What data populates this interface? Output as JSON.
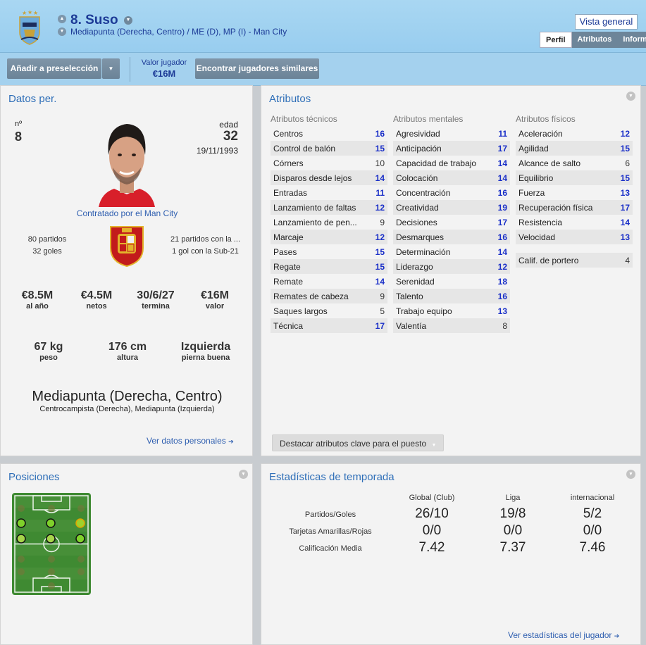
{
  "header": {
    "number_name": "8. Suso",
    "positions": "Mediapunta (Derecha, Centro) / ME (D), MP (I) - Man City",
    "vista_general": "Vista general",
    "tabs": [
      "Perfil",
      "Atributos",
      "Inform"
    ]
  },
  "toolbar": {
    "shortlist": "Añadir a preselección",
    "value_label": "Valor jugador",
    "value": "€16M",
    "similar": "Encontrar jugadores similares"
  },
  "datos": {
    "title": "Datos per.",
    "num_label": "nº",
    "num": "8",
    "age_label": "edad",
    "age": "32",
    "dob": "19/11/1993",
    "contract_status": "Contratado por el Man City",
    "club_matches": "80 partidos",
    "club_goals": "32 goles",
    "intl_matches": "21 partidos con la ...",
    "intl_goals": "1 gol con la Sub-21",
    "wage": "€8.5M",
    "wage_label": "al año",
    "net": "€4.5M",
    "net_label": "netos",
    "expires": "30/6/27",
    "expires_label": "termina",
    "value": "€16M",
    "value_label": "valor",
    "weight": "67 kg",
    "weight_label": "peso",
    "height": "176 cm",
    "height_label": "altura",
    "foot": "Izquierda",
    "foot_label": "pierna buena",
    "main_position": "Mediapunta (Derecha, Centro)",
    "other_positions": "Centrocampista (Derecha), Mediapunta (Izquierda)",
    "link": "Ver datos personales"
  },
  "atributos": {
    "title": "Atributos",
    "tecnicos": {
      "title": "Atributos técnicos",
      "items": [
        {
          "name": "Centros",
          "value": "16"
        },
        {
          "name": "Control de balón",
          "value": "15"
        },
        {
          "name": "Córners",
          "value": "10"
        },
        {
          "name": "Disparos desde lejos",
          "value": "14"
        },
        {
          "name": "Entradas",
          "value": "11"
        },
        {
          "name": "Lanzamiento de faltas",
          "value": "12"
        },
        {
          "name": "Lanzamiento de pen...",
          "value": "9"
        },
        {
          "name": "Marcaje",
          "value": "12"
        },
        {
          "name": "Pases",
          "value": "15"
        },
        {
          "name": "Regate",
          "value": "15"
        },
        {
          "name": "Remate",
          "value": "14"
        },
        {
          "name": "Remates de cabeza",
          "value": "9"
        },
        {
          "name": "Saques largos",
          "value": "5"
        },
        {
          "name": "Técnica",
          "value": "17"
        }
      ]
    },
    "mentales": {
      "title": "Atributos mentales",
      "items": [
        {
          "name": "Agresividad",
          "value": "11"
        },
        {
          "name": "Anticipación",
          "value": "17"
        },
        {
          "name": "Capacidad de trabajo",
          "value": "14"
        },
        {
          "name": "Colocación",
          "value": "14"
        },
        {
          "name": "Concentración",
          "value": "16"
        },
        {
          "name": "Creatividad",
          "value": "19"
        },
        {
          "name": "Decisiones",
          "value": "17"
        },
        {
          "name": "Desmarques",
          "value": "16"
        },
        {
          "name": "Determinación",
          "value": "14"
        },
        {
          "name": "Liderazgo",
          "value": "12"
        },
        {
          "name": "Serenidad",
          "value": "18"
        },
        {
          "name": "Talento",
          "value": "16"
        },
        {
          "name": "Trabajo equipo",
          "value": "13"
        },
        {
          "name": "Valentía",
          "value": "8"
        }
      ]
    },
    "fisicos": {
      "title": "Atributos físicos",
      "items": [
        {
          "name": "Aceleración",
          "value": "12"
        },
        {
          "name": "Agilidad",
          "value": "15"
        },
        {
          "name": "Alcance de salto",
          "value": "6"
        },
        {
          "name": "Equilibrio",
          "value": "15"
        },
        {
          "name": "Fuerza",
          "value": "13"
        },
        {
          "name": "Recuperación física",
          "value": "17"
        },
        {
          "name": "Resistencia",
          "value": "14"
        },
        {
          "name": "Velocidad",
          "value": "13"
        }
      ],
      "gk_label": "Calif. de portero",
      "gk_value": "4"
    },
    "highlight_button": "Destacar atributos clave para el puesto"
  },
  "posiciones": {
    "title": "Posiciones"
  },
  "stats": {
    "title": "Estadísticas de temporada",
    "columns": [
      "Global (Club)",
      "Liga",
      "internacional"
    ],
    "rows": [
      {
        "label": "Partidos/Goles",
        "values": [
          "26/10",
          "19/8",
          "5/2"
        ]
      },
      {
        "label": "Tarjetas Amarillas/Rojas",
        "values": [
          "0/0",
          "0/0",
          "0/0"
        ]
      },
      {
        "label": "Calificación Media",
        "values": [
          "7.42",
          "7.37",
          "7.46"
        ]
      }
    ],
    "link": "Ver estadísticas del jugador"
  }
}
